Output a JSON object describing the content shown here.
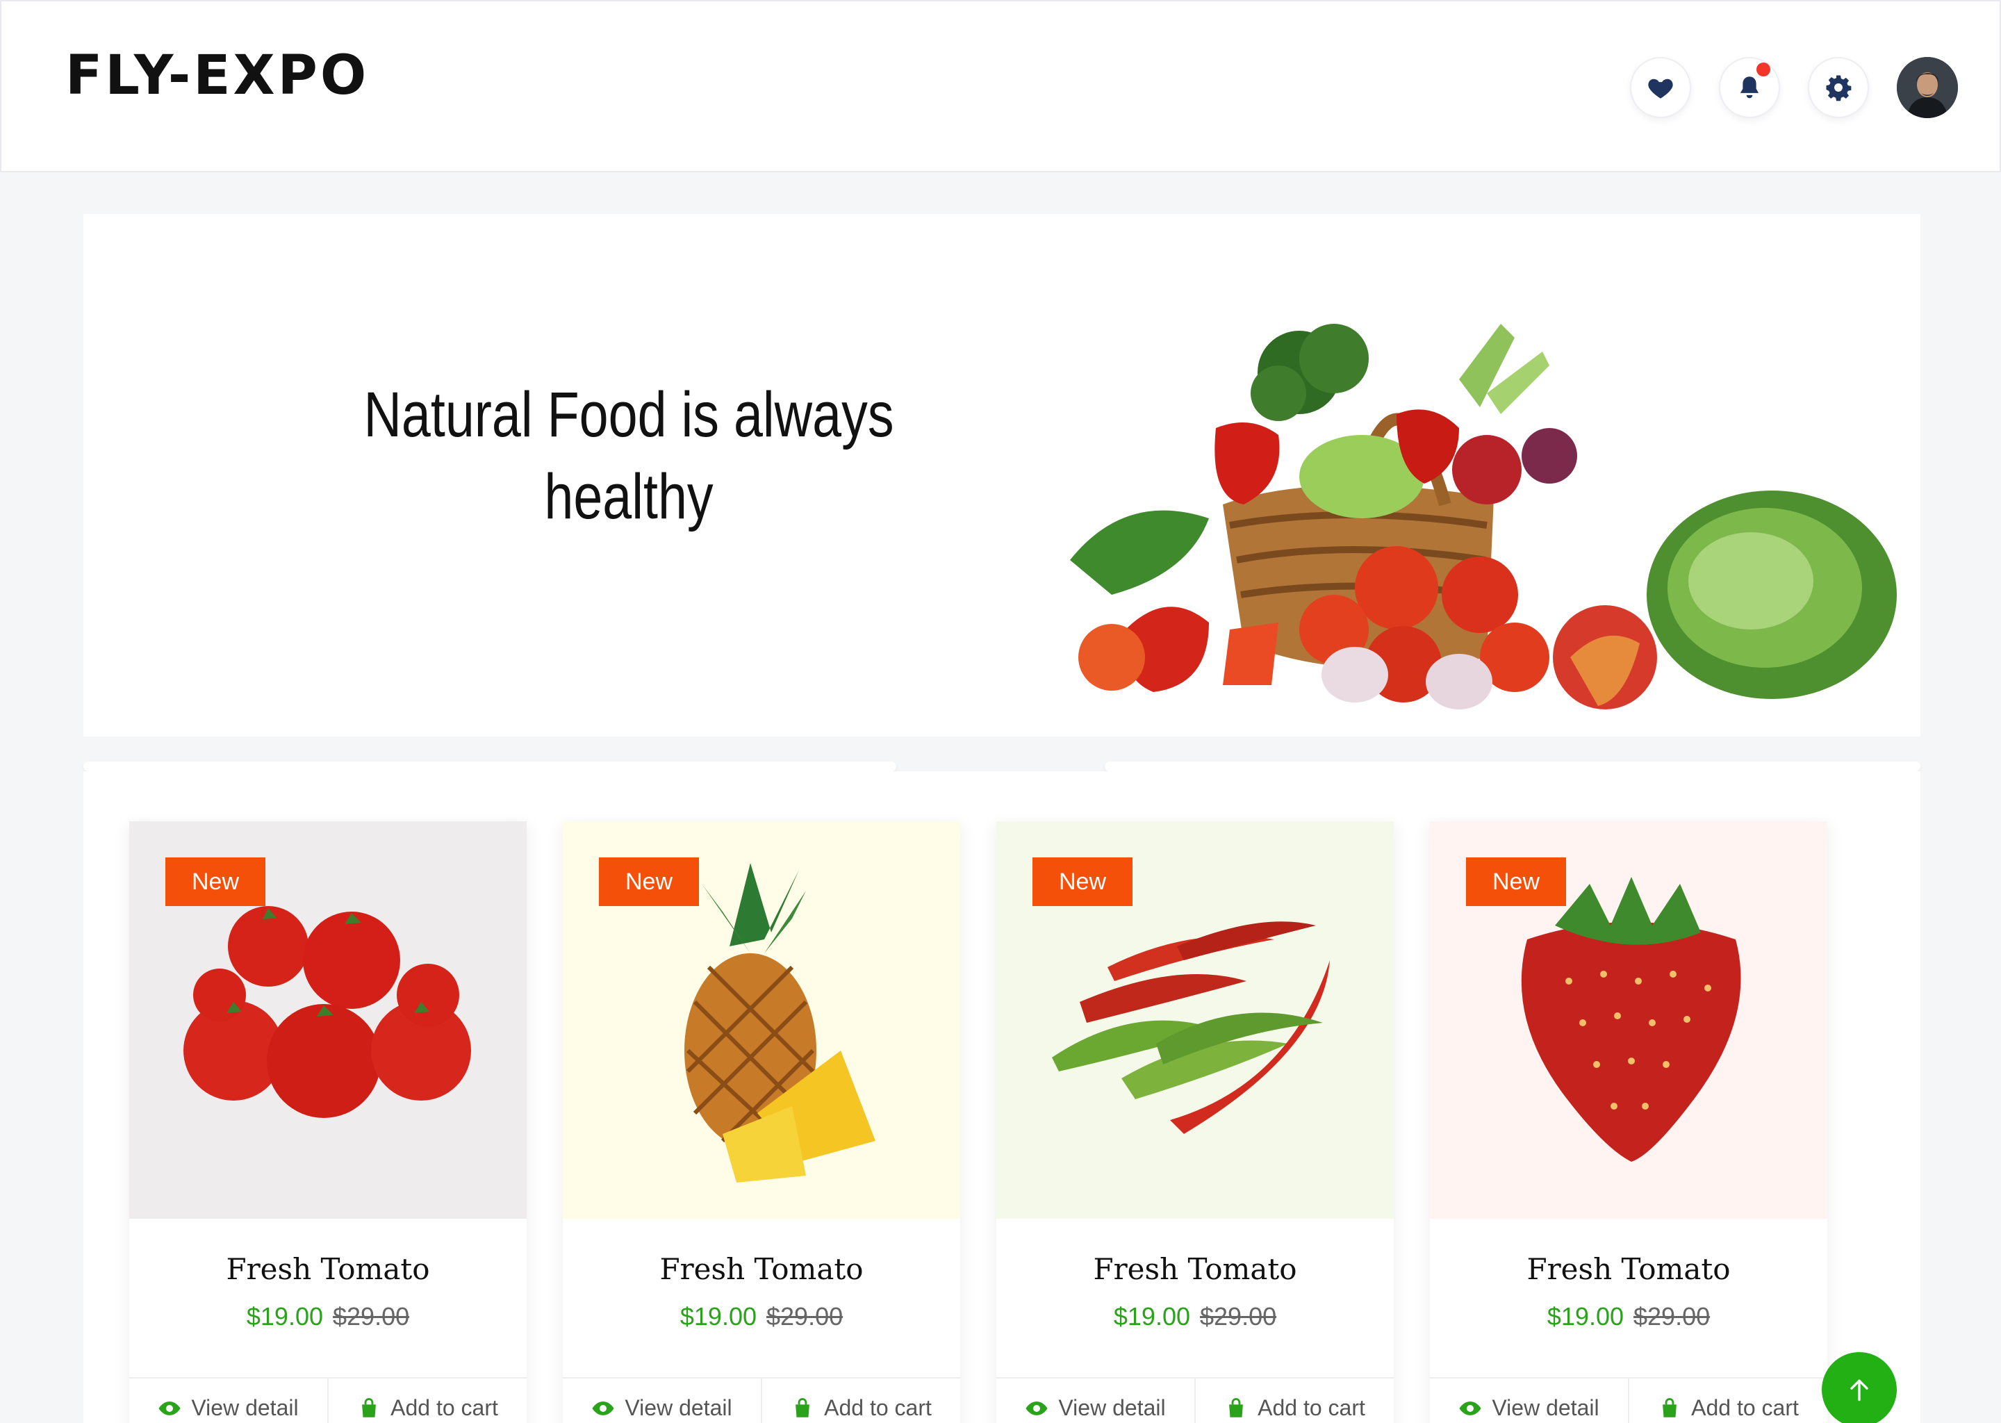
{
  "header": {
    "logo": "FLY-EXPO",
    "icons": [
      "heart-icon",
      "bell-icon",
      "gear-icon"
    ],
    "has_notification": true
  },
  "hero": {
    "headline_line1": "Natural Food is always",
    "headline_line2": "healthy"
  },
  "products": [
    {
      "badge": "New",
      "name": "Fresh Tomato",
      "price": "$19.00",
      "old_price": "$29.00",
      "view_label": "View detail",
      "cart_label": "Add to cart",
      "bg": "#efeced"
    },
    {
      "badge": "New",
      "name": "Fresh Tomato",
      "price": "$19.00",
      "old_price": "$29.00",
      "view_label": "View detail",
      "cart_label": "Add to cart",
      "bg": "#fffde8"
    },
    {
      "badge": "New",
      "name": "Fresh Tomato",
      "price": "$19.00",
      "old_price": "$29.00",
      "view_label": "View detail",
      "cart_label": "Add to cart",
      "bg": "#f5f9ea"
    },
    {
      "badge": "New",
      "name": "Fresh Tomato",
      "price": "$19.00",
      "old_price": "$29.00",
      "view_label": "View detail",
      "cart_label": "Add to cart",
      "bg": "#fff4f2"
    }
  ],
  "colors": {
    "accent_green": "#22b014",
    "badge_orange": "#f4500a",
    "icon_navy": "#1f3560",
    "notification_red": "#f2372a"
  }
}
